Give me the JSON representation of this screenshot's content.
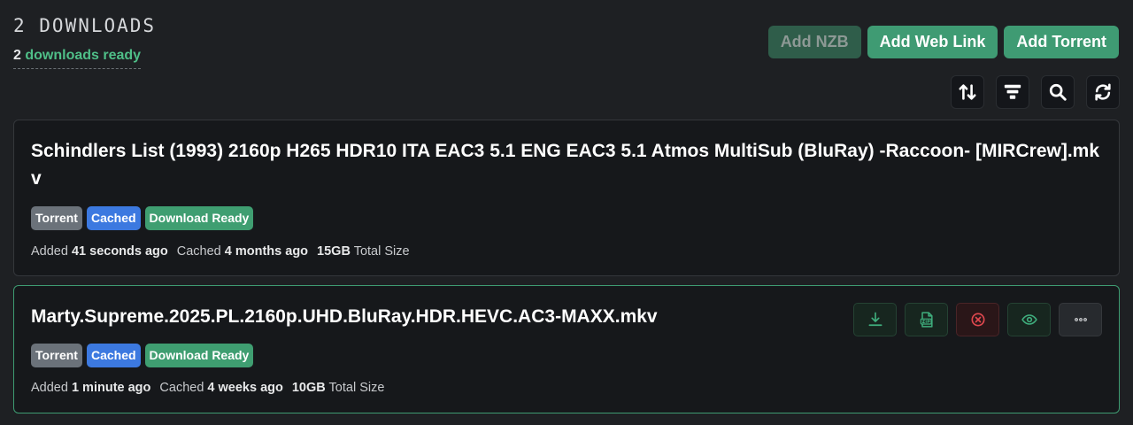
{
  "header": {
    "title": "2 DOWNLOADS",
    "ready_count": "2",
    "ready_text": " downloads ready"
  },
  "actions": {
    "add_nzb": "Add NZB",
    "add_web_link": "Add Web Link",
    "add_torrent": "Add Torrent"
  },
  "toolbar": {
    "icons": [
      "sort-icon",
      "filter-icon",
      "search-icon",
      "refresh-icon"
    ]
  },
  "downloads": [
    {
      "title": "Schindlers List (1993) 2160p H265 HDR10 ITA EAC3 5.1 ENG EAC3 5.1 Atmos MultiSub (BluRay) -Raccoon- [MIRCrew].mkv",
      "tags": [
        "Torrent",
        "Cached",
        "Download Ready"
      ],
      "added_label": "Added",
      "added_value": "41 seconds ago",
      "cached_label": "Cached",
      "cached_value": "4 months ago",
      "size_value": "15GB",
      "size_label": "Total Size"
    },
    {
      "title": "Marty.Supreme.2025.PL.2160p.UHD.BluRay.HDR.HEVC.AC3-MAXX.mkv",
      "tags": [
        "Torrent",
        "Cached",
        "Download Ready"
      ],
      "added_label": "Added",
      "added_value": "1 minute ago",
      "cached_label": "Cached",
      "cached_value": "4 weeks ago",
      "size_value": "10GB",
      "size_label": "Total Size",
      "row_actions": [
        "download-icon",
        "zip-icon",
        "delete-icon",
        "view-icon",
        "more-icon"
      ]
    }
  ],
  "colors": {
    "background": "#1e2023",
    "card": "#16181b",
    "accent_green": "#3f9e71",
    "accent_blue": "#3c79e0",
    "tag_gray": "#6b727a"
  }
}
